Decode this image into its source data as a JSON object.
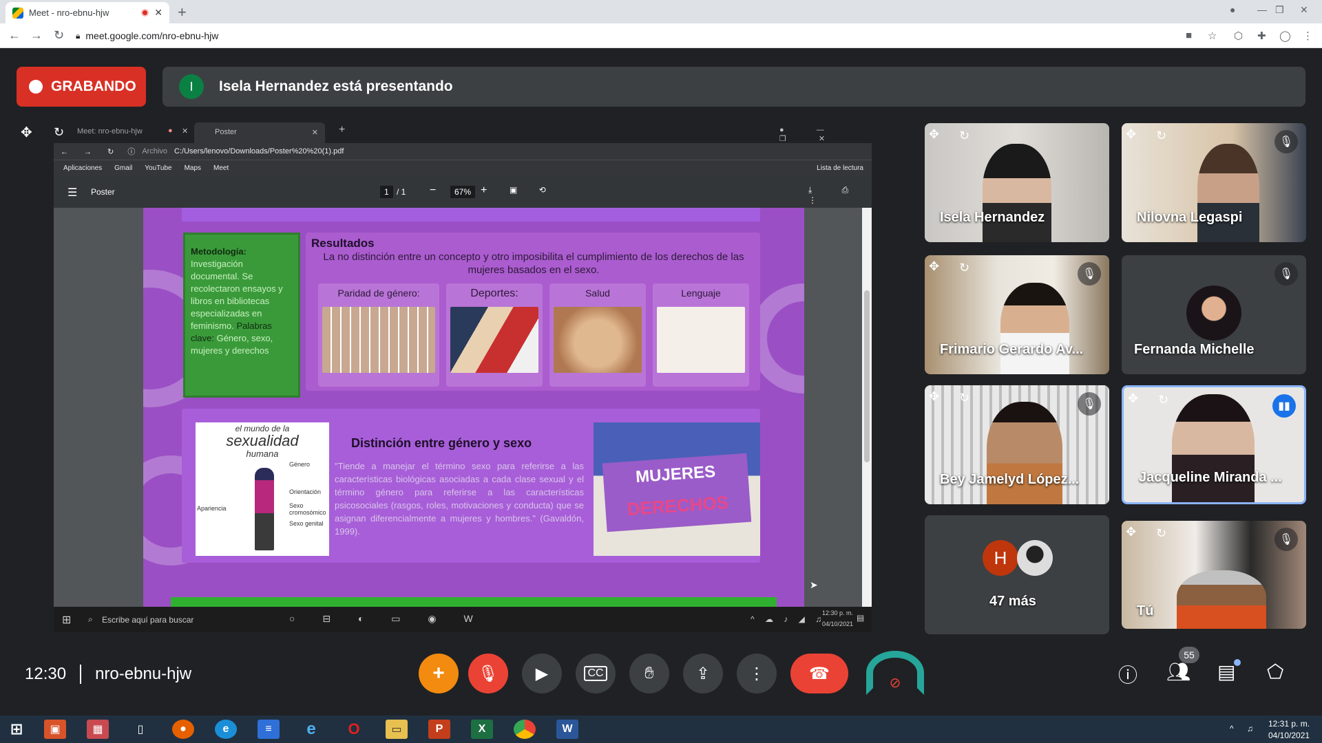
{
  "browser": {
    "tab_title": "Meet - nro-ebnu-hjw",
    "url": "meet.google.com/nro-ebnu-hjw"
  },
  "recording": {
    "label": "GRABANDO"
  },
  "presenter": {
    "initial": "I",
    "text": "Isela Hernandez está presentando"
  },
  "shared": {
    "tab1": "Meet: nro-ebnu-hjw",
    "tab2": "Poster",
    "archivo": "Archivo",
    "path": "C:/Users/lenovo/Downloads/Poster%20%20(1).pdf",
    "bookmarks": [
      "Aplicaciones",
      "Gmail",
      "YouTube",
      "Maps",
      "Meet"
    ],
    "reading_list": "Lista de lectura",
    "pdf_title": "Poster",
    "page_current": "1",
    "page_total": "/ 1",
    "zoom": "67%",
    "search_placeholder": "Escribe aquí para buscar",
    "tray_time": "12:30 p. m.",
    "tray_date": "04/10/2021"
  },
  "poster": {
    "metodologia_title": "Metodología:",
    "metodologia_body": "Investigación documental. Se recolectaron ensayos y libros en bibliotecas especializadas en feminismo.",
    "palabras_clave_label": "Palabras clave:",
    "palabras_clave": "Género, sexo, mujeres y derechos",
    "resultados_title": "Resultados",
    "resultados_body": "La no distinción entre un concepto y otro imposibilita el cumplimiento de los derechos de las mujeres basados en el sexo.",
    "cards": [
      "Paridad de género:",
      "Deportes:",
      "Salud",
      "Lenguaje"
    ],
    "sexualidad_top": "el mundo de la",
    "sexualidad_big": "sexualidad",
    "sexualidad_sub": "humana",
    "diagram_labels": [
      "Género",
      "Orientación",
      "Sexo cromosómico",
      "Sexo genital",
      "Apariencia"
    ],
    "distincion_title": "Distinción entre género y sexo",
    "distincion_quote": "\"Tiende a manejar el término sexo para referirse a las características biológicas asociadas a cada clase sexual y el término género para referirse a las características psicosociales (rasgos, roles, motivaciones y conducta) que se asignan diferencialmente a mujeres y hombres.\" (Gavaldón, 1999).",
    "mujeres": "MUJERES",
    "derechos": "DERECHOS"
  },
  "participants": [
    {
      "name": "Isela Hernandez",
      "muted": false
    },
    {
      "name": "Nilovna Legaspi",
      "muted": true
    },
    {
      "name": "Frimario Gerardo Av...",
      "muted": true
    },
    {
      "name": "Fernanda Michelle",
      "muted": true
    },
    {
      "name": "Bey Jamelyd López...",
      "muted": true
    },
    {
      "name": "Jacqueline Miranda ...",
      "muted": false,
      "speaking": true
    },
    {
      "name": "47 más",
      "avatar_initial": "H"
    },
    {
      "name": "Tú",
      "muted": true
    }
  ],
  "bottom": {
    "time": "12:30",
    "meeting_code": "nro-ebnu-hjw",
    "participant_count": "55"
  },
  "taskbar": {
    "time": "12:31 p. m.",
    "date": "04/10/2021"
  },
  "colors": {
    "record_red": "#d93025",
    "meet_bg": "#202124",
    "tile_bg": "#3c4043",
    "speaking_blue": "#1a73e8",
    "activity_orange": "#f28b0f"
  }
}
